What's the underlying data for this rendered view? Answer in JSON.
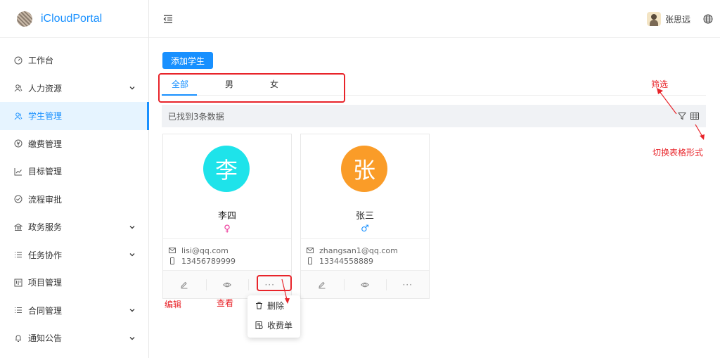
{
  "app": {
    "title": "iCloudPortal"
  },
  "sidebar": {
    "items": [
      {
        "label": "工作台",
        "icon": "dashboard-icon",
        "expandable": false,
        "active": false
      },
      {
        "label": "人力资源",
        "icon": "users-icon",
        "expandable": true,
        "active": false
      },
      {
        "label": "学生管理",
        "icon": "users-icon",
        "expandable": false,
        "active": true
      },
      {
        "label": "缴费管理",
        "icon": "yen-icon",
        "expandable": false,
        "active": false
      },
      {
        "label": "目标管理",
        "icon": "chart-line-icon",
        "expandable": false,
        "active": false
      },
      {
        "label": "流程审批",
        "icon": "check-circle-icon",
        "expandable": false,
        "active": false
      },
      {
        "label": "政务服务",
        "icon": "bank-icon",
        "expandable": true,
        "active": false
      },
      {
        "label": "任务协作",
        "icon": "list-icon",
        "expandable": true,
        "active": false
      },
      {
        "label": "项目管理",
        "icon": "project-icon",
        "expandable": false,
        "active": false
      },
      {
        "label": "合同管理",
        "icon": "list-icon",
        "expandable": true,
        "active": false
      },
      {
        "label": "通知公告",
        "icon": "bell-icon",
        "expandable": true,
        "active": false
      }
    ]
  },
  "header": {
    "user_name": "张思远"
  },
  "toolbar": {
    "add_label": "添加学生"
  },
  "tabs": [
    {
      "label": "全部",
      "active": true
    },
    {
      "label": "男",
      "active": false
    },
    {
      "label": "女",
      "active": false
    }
  ],
  "result_bar": {
    "text": "已找到3条数据"
  },
  "cards": [
    {
      "avatar_char": "李",
      "avatar_color": "#1ee3ea",
      "name": "李四",
      "gender_symbol": "♀",
      "gender_color": "#eb2f96",
      "email": "lisi@qq.com",
      "phone": "13456789999",
      "more_label": "···"
    },
    {
      "avatar_char": "张",
      "avatar_color": "#fa9c28",
      "name": "张三",
      "gender_symbol": "♂",
      "gender_color": "#1890ff",
      "email": "zhangsan1@qq.com",
      "phone": "13344558889",
      "more_label": "···"
    }
  ],
  "dropdown": {
    "items": [
      {
        "label": "删除",
        "icon": "trash-icon"
      },
      {
        "label": "收费单",
        "icon": "receipt-icon"
      }
    ]
  },
  "annotations": {
    "filter": "筛选",
    "switch_table": "切换表格形式",
    "edit": "编辑",
    "view": "查看"
  },
  "colors": {
    "primary": "#1890ff",
    "annotation_red": "#e8242a"
  }
}
